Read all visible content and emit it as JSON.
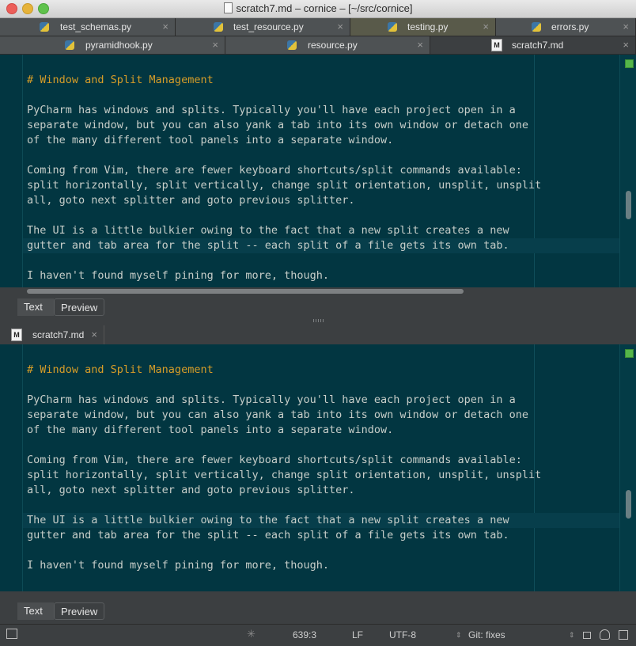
{
  "window": {
    "title": "scratch7.md – cornice – [~/src/cornice]"
  },
  "tabs_row1": [
    {
      "label": "test_schemas.py",
      "icon": "python-file-icon"
    },
    {
      "label": "test_resource.py",
      "icon": "python-file-icon"
    },
    {
      "label": "testing.py",
      "icon": "python-file-icon"
    },
    {
      "label": "errors.py",
      "icon": "python-file-icon"
    }
  ],
  "tabs_row2": [
    {
      "label": "pyramidhook.py",
      "icon": "python-file-icon"
    },
    {
      "label": "resource.py",
      "icon": "python-file-icon"
    },
    {
      "label": "scratch7.md",
      "icon": "markdown-file-icon"
    }
  ],
  "close_glyph": "×",
  "lower_pane": {
    "tab_label": "scratch7.md",
    "md_glyph": "M"
  },
  "editor": {
    "lines": [
      "# Window and Split Management",
      "",
      "PyCharm has windows and splits. Typically you'll have each project open in a",
      "separate window, but you can also yank a tab into its own window or detach one",
      "of the many different tool panels into a separate window.",
      "",
      "Coming from Vim, there are fewer keyboard shortcuts/split commands available:",
      "split horizontally, split vertically, change split orientation, unsplit, unsplit",
      "all, goto next splitter and goto previous splitter.",
      "",
      "The UI is a little bulkier owing to the fact that a new split creates a new",
      "gutter and tab area for the split -- each split of a file gets its own tab.",
      "",
      "I haven't found myself pining for more, though."
    ]
  },
  "mode_tabs": {
    "text": "Text",
    "preview": "Preview"
  },
  "status": {
    "position": "639:3",
    "line_sep": "LF",
    "encoding": "UTF-8",
    "vcs": "Git: fixes"
  },
  "colors": {
    "editor_bg": "#023641",
    "heading": "#d79d28",
    "text": "#c7cec9",
    "ok_marker": "#55b64a"
  }
}
